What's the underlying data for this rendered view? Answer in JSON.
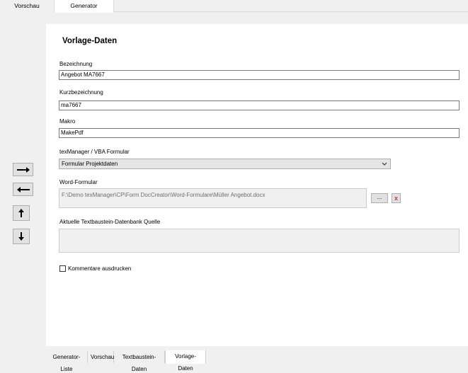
{
  "top_tabs": [
    {
      "label": "Vorschau"
    },
    {
      "label": "Generator"
    }
  ],
  "form": {
    "title": "Vorlage-Daten",
    "bezeichnung": {
      "label": "Bezeichnung",
      "value": "Angebot MA7667"
    },
    "kurzbezeichnung": {
      "label": "Kurzbezeichnung",
      "value": "ma7667"
    },
    "makro": {
      "label": "Makro",
      "value": "MakePdf"
    },
    "texmanager": {
      "label": "texManager / VBA Formular",
      "selected": "Formular Projektdaten"
    },
    "word_formular": {
      "label": "Word-Formular",
      "value": "F:\\Demo texManager\\CP\\Form DocCreator\\Word-Formulare\\Müller Angebot.docx",
      "browse_label": "...",
      "clear_label": "x"
    },
    "source": {
      "label": "Aktuelle Textbaustein-Datenbank Quelle",
      "value": ""
    },
    "print_comments": {
      "label": "Kommentare ausdrucken",
      "checked": false
    }
  },
  "side_buttons": [
    {
      "icon": "arrow-right-icon"
    },
    {
      "icon": "arrow-left-icon"
    },
    {
      "icon": "arrow-up-icon"
    },
    {
      "icon": "arrow-down-icon"
    }
  ],
  "bottom_tabs": [
    {
      "label": "Generator-Liste"
    },
    {
      "label": "Vorschau"
    },
    {
      "label": "Textbaustein-Daten"
    },
    {
      "label": "Vorlage-Daten"
    }
  ],
  "colors": {
    "panel": "#ffffff",
    "background": "#f0f0f0",
    "clear_x": "#c0392b"
  }
}
